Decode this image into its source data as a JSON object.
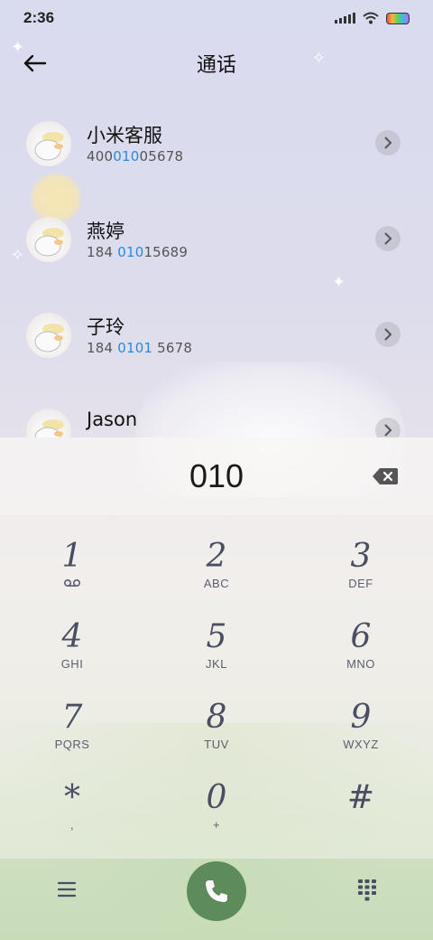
{
  "status_bar": {
    "time": "2:36",
    "icons": [
      "signal-icon",
      "wifi-icon",
      "battery-icon"
    ]
  },
  "header": {
    "title": "通话",
    "back_icon": "arrow-left-icon"
  },
  "contacts": [
    {
      "name": "小米客服",
      "number_parts": [
        "400",
        "010",
        "05678"
      ]
    },
    {
      "name": "燕婷",
      "number_parts": [
        "184 ",
        "010",
        "15689"
      ]
    },
    {
      "name": "子玲",
      "number_parts": [
        "184 ",
        "0101",
        " 5678"
      ]
    },
    {
      "name": "Jason",
      "number_parts": [
        "",
        "",
        ""
      ]
    }
  ],
  "dialer": {
    "input_value": "010",
    "backspace_icon": "backspace-icon"
  },
  "keypad": [
    {
      "digit": "1",
      "letters": ""
    },
    {
      "digit": "2",
      "letters": "ABC"
    },
    {
      "digit": "3",
      "letters": "DEF"
    },
    {
      "digit": "4",
      "letters": "GHI"
    },
    {
      "digit": "5",
      "letters": "JKL"
    },
    {
      "digit": "6",
      "letters": "MNO"
    },
    {
      "digit": "7",
      "letters": "PQRS"
    },
    {
      "digit": "8",
      "letters": "TUV"
    },
    {
      "digit": "9",
      "letters": "WXYZ"
    },
    {
      "digit": "*",
      "letters": ","
    },
    {
      "digit": "0",
      "letters": "+"
    },
    {
      "digit": "#",
      "letters": ""
    }
  ],
  "bottom_bar": {
    "icons": [
      "menu-icon",
      "phone-icon",
      "dialpad-icon"
    ]
  },
  "colors": {
    "highlight": "#2a89e0",
    "call_button": "#5e8b5c",
    "keypad_digit": "#4a4e63"
  }
}
